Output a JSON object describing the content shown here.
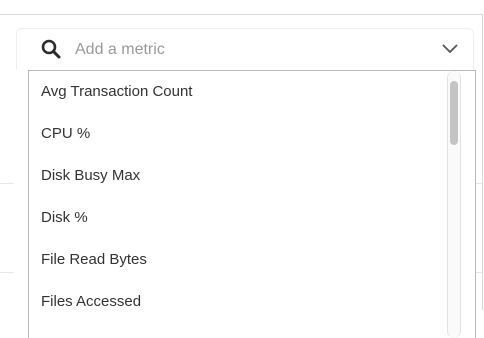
{
  "search": {
    "placeholder": "Add a metric",
    "icon": "search-icon"
  },
  "dropdown": {
    "toggle_icon": "chevron-down-icon"
  },
  "metrics": [
    "Avg Transaction Count",
    "CPU %",
    "Disk Busy Max",
    "Disk %",
    "File Read Bytes",
    "Files Accessed"
  ],
  "colors": {
    "text": "#333333",
    "placeholder": "#9a9a9a",
    "border": "#b9b9b9",
    "scroll_thumb": "#c4c4c4"
  }
}
